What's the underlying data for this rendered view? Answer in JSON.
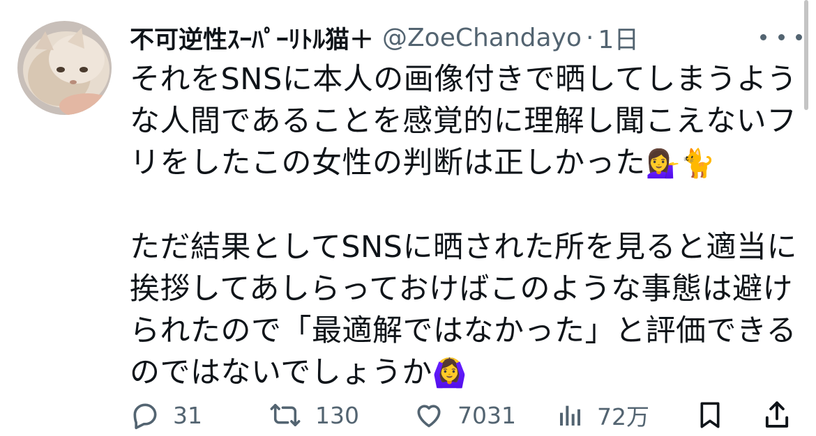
{
  "author": {
    "display_name": "不可逆性ｽｰﾊﾟｰﾘﾄﾙ猫＋",
    "handle": "@ZoeChandayo",
    "separator": "·",
    "time": "1日",
    "avatar_icon": "cat-avatar-icon"
  },
  "tweet": {
    "lines_p1": [
      "それをSNSに本人の画像付きで晒してしまうよう",
      "な人間であることを感覚的に理解し聞こえないフ",
      "リをしたこの女性の判断は正しかった"
    ],
    "emoji_p1": "💁‍♀️🐈",
    "lines_p2": [
      "ただ結果としてSNSに晒された所を見ると適当に",
      "挨拶してあしらっておけばこのような事態は避け",
      "られたので「最適解ではなかった」と評価できる",
      "のではないでしょうか"
    ],
    "emoji_p2": "🙆‍♀️"
  },
  "actions": {
    "replies": "31",
    "retweets": "130",
    "likes": "7031",
    "views": "72万"
  },
  "colors": {
    "text": "#0f1419",
    "secondary": "#536471",
    "background": "#ffffff"
  }
}
